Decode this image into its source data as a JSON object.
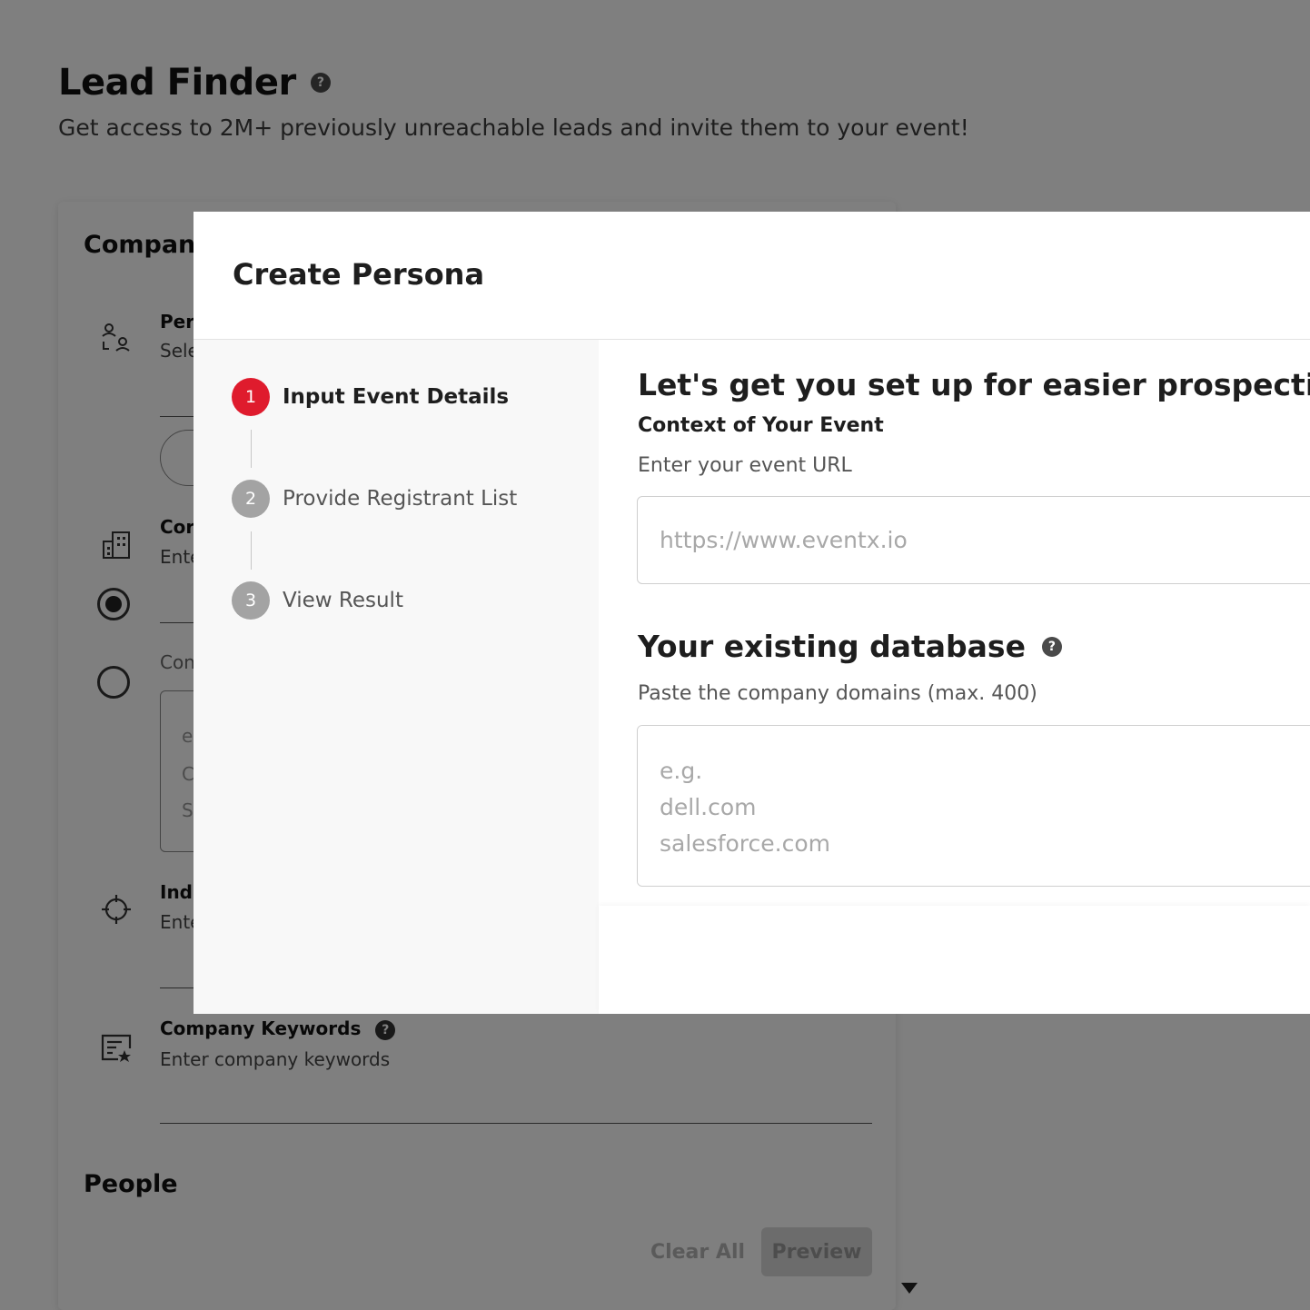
{
  "page": {
    "title": "Lead Finder",
    "help_glyph": "?",
    "subtitle": "Get access to 2M+ previously unreachable leads and invite them to your event!"
  },
  "filters": {
    "company_section": "Company",
    "persona_label": "Pers",
    "persona_sub": "Sele",
    "company_label": "Cor",
    "company_sub": "Ente",
    "company_alt_label": "Con",
    "textbox_lines": [
      "e",
      "C",
      "S"
    ],
    "industry_label": "Indu",
    "industry_sub": "Ente",
    "keywords_label": "Company Keywords",
    "keywords_sub": "Enter company keywords",
    "people_section": "People",
    "clear_all": "Clear All",
    "preview": "Preview"
  },
  "modal": {
    "title": "Create Persona",
    "steps": [
      {
        "number": "1",
        "label": "Input Event Details",
        "state": "active"
      },
      {
        "number": "2",
        "label": "Provide Registrant List",
        "state": "inactive"
      },
      {
        "number": "3",
        "label": "View Result",
        "state": "inactive"
      }
    ],
    "heading": "Let's get you set up for easier prospecting",
    "context_label": "Context of Your Event",
    "url_label": "Enter your event URL",
    "url_placeholder": "https://www.eventx.io",
    "url_value": "",
    "db_heading": "Your existing database",
    "db_help_glyph": "?",
    "db_label": "Paste the company domains (max. 400)",
    "db_placeholder": "e.g.\ndell.com\nsalesforce.com",
    "db_value": ""
  },
  "colors": {
    "accent": "#df1b2d",
    "step_inactive": "#a3a3a3",
    "overlay": "rgba(0,0,0,0.5)"
  },
  "icons": {
    "help": "help-icon",
    "persona": "persona-icon",
    "company": "building-icon",
    "industry": "crosshair-icon",
    "keywords": "keywords-icon",
    "scroll": "caret-down-icon"
  }
}
